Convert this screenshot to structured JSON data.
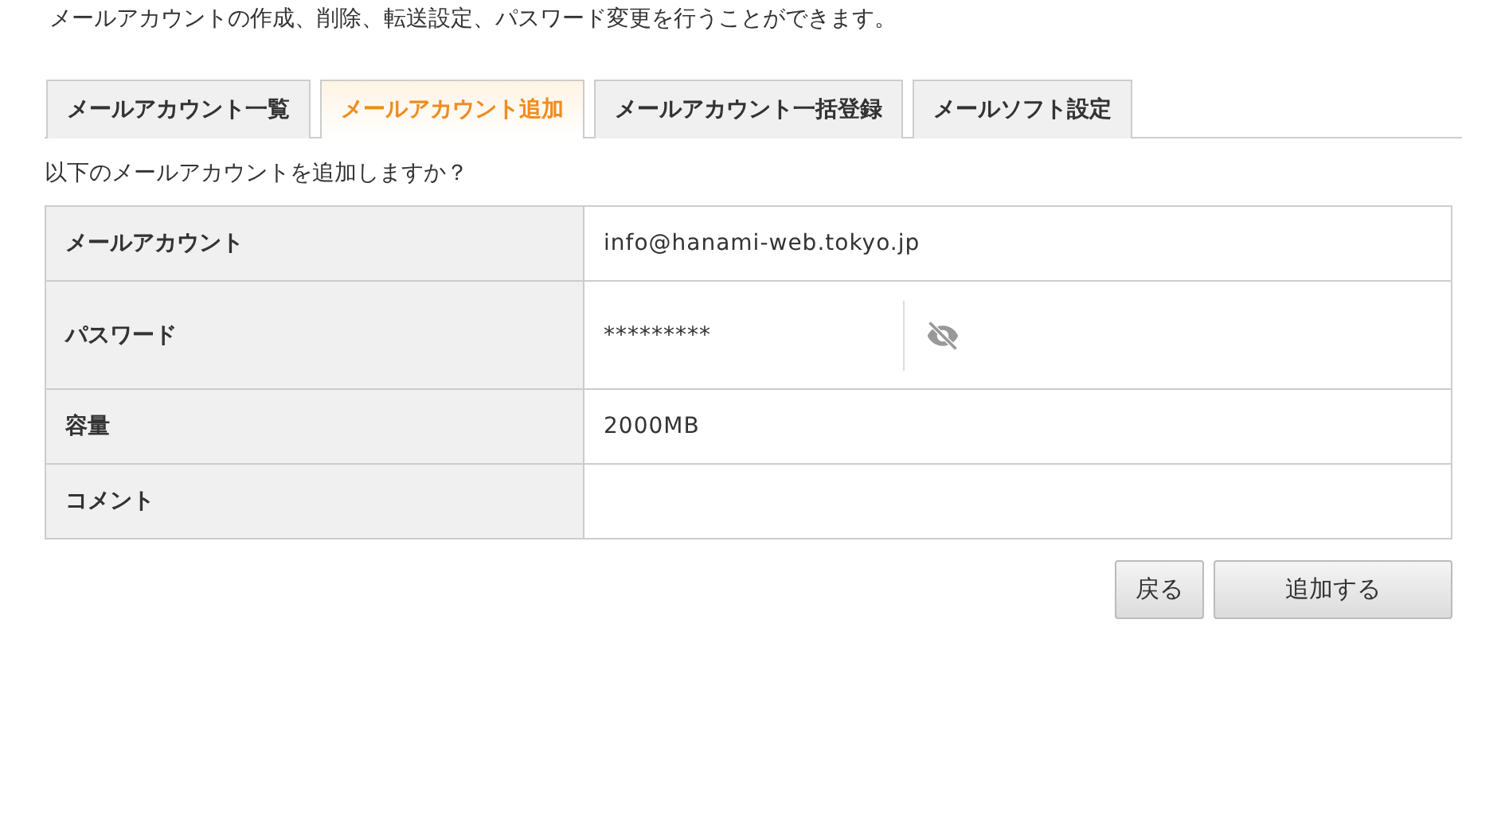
{
  "intro": "メールアカウントの作成、削除、転送設定、パスワード変更を行うことができます。",
  "tabs": [
    {
      "label": "メールアカウント一覧",
      "selected": false
    },
    {
      "label": "メールアカウント追加",
      "selected": true
    },
    {
      "label": "メールアカウント一括登録",
      "selected": false
    },
    {
      "label": "メールソフト設定",
      "selected": false
    }
  ],
  "question": "以下のメールアカウントを追加しますか？",
  "rows": [
    {
      "kind": "text",
      "label": "メールアカウント",
      "value": "info@hanami-web.tokyo.jp"
    },
    {
      "kind": "password",
      "label": "パスワード",
      "value": "*********"
    },
    {
      "kind": "text",
      "label": "容量",
      "value": "2000MB"
    },
    {
      "kind": "text",
      "label": "コメント"
    }
  ],
  "buttons": [
    {
      "label": "戻る"
    },
    {
      "label": "追加する"
    }
  ]
}
